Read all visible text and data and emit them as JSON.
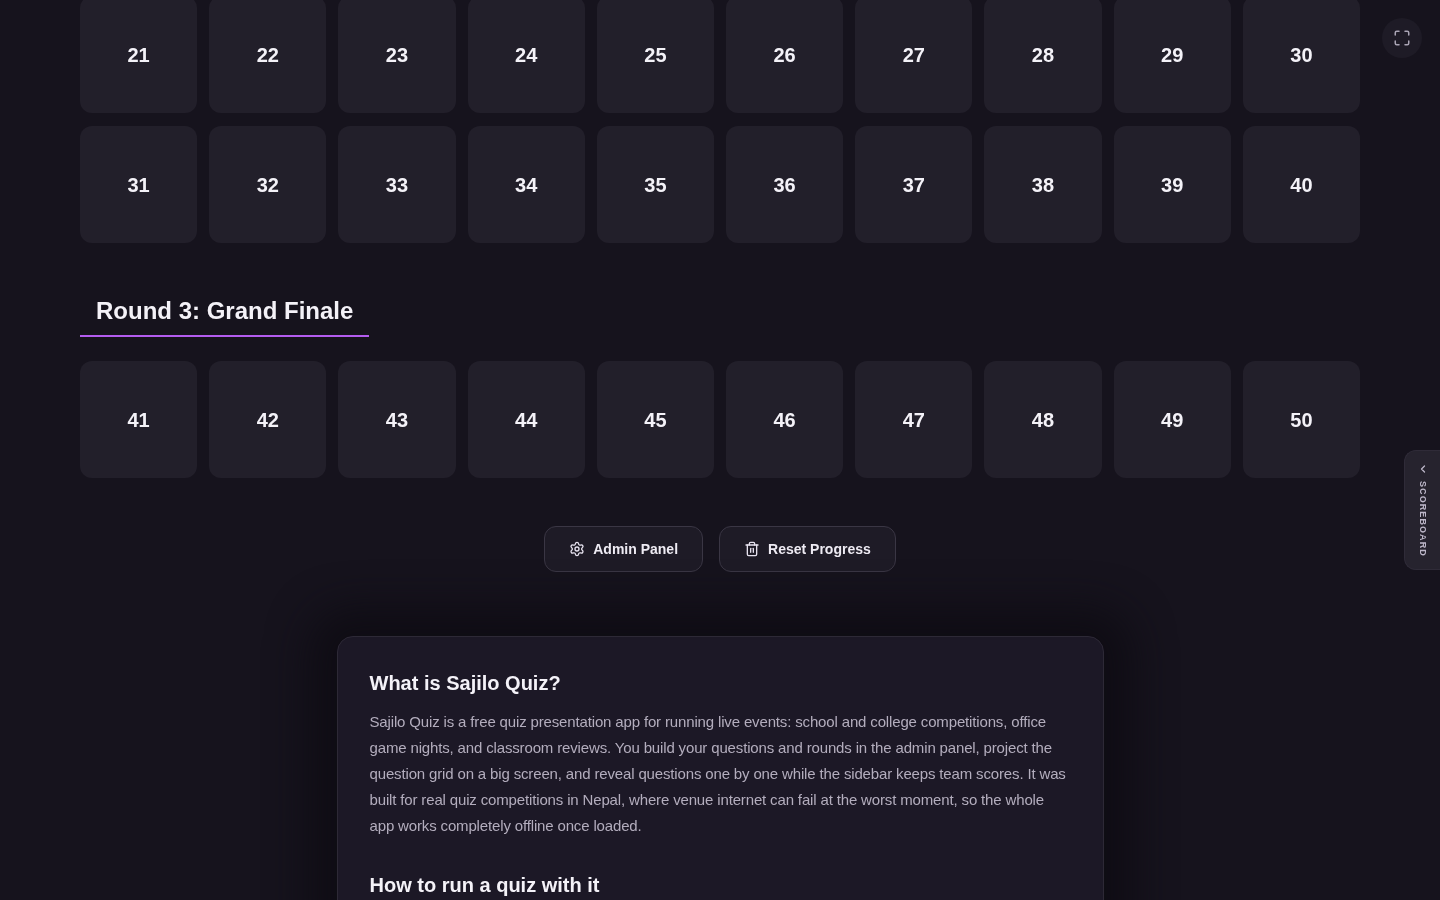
{
  "rounds": [
    {
      "tiles": [
        "21",
        "22",
        "23",
        "24",
        "25",
        "26",
        "27",
        "28",
        "29",
        "30",
        "31",
        "32",
        "33",
        "34",
        "35",
        "36",
        "37",
        "38",
        "39",
        "40"
      ]
    },
    {
      "title": "Round 3: Grand Finale",
      "tiles": [
        "41",
        "42",
        "43",
        "44",
        "45",
        "46",
        "47",
        "48",
        "49",
        "50"
      ]
    }
  ],
  "actions": [
    {
      "kind": "settings",
      "label": "Admin Panel"
    },
    {
      "kind": "delete",
      "label": "Reset Progress"
    }
  ],
  "about": {
    "sections": [
      {
        "heading": "What is Sajilo Quiz?",
        "body": "Sajilo Quiz is a free quiz presentation app for running live events: school and college competitions, office game nights, and classroom reviews. You build your questions and rounds in the admin panel, project the question grid on a big screen, and reveal questions one by one while the sidebar keeps team scores. It was built for real quiz competitions in Nepal, where venue internet can fail at the worst moment, so the whole app works completely offline once loaded."
      },
      {
        "heading": "How to run a quiz with it"
      }
    ]
  },
  "scoreboard_tab": {
    "label": "SCOREBOARD"
  }
}
